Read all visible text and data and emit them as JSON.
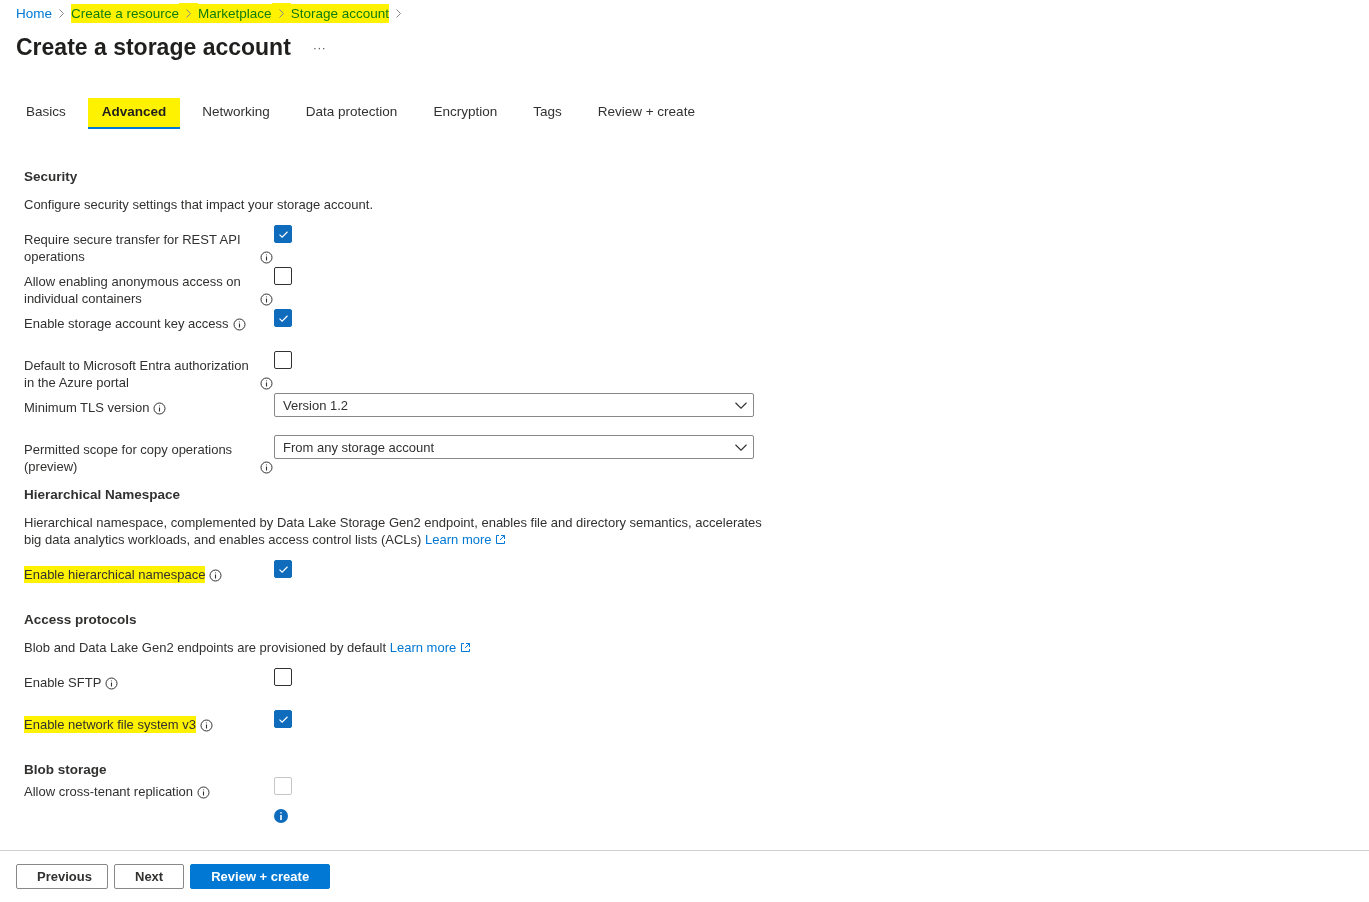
{
  "breadcrumb": [
    {
      "label": "Home",
      "highlighted": false
    },
    {
      "label": "Create a resource",
      "highlighted": true
    },
    {
      "label": "Marketplace",
      "highlighted": true
    },
    {
      "label": "Storage account",
      "highlighted": true
    }
  ],
  "title": "Create a storage account",
  "more_button": "···",
  "tabs": [
    {
      "label": "Basics",
      "selected": false,
      "highlighted": false
    },
    {
      "label": "Advanced",
      "selected": true,
      "highlighted": true
    },
    {
      "label": "Networking",
      "selected": false,
      "highlighted": false
    },
    {
      "label": "Data protection",
      "selected": false,
      "highlighted": false
    },
    {
      "label": "Encryption",
      "selected": false,
      "highlighted": false
    },
    {
      "label": "Tags",
      "selected": false,
      "highlighted": false
    },
    {
      "label": "Review + create",
      "selected": false,
      "highlighted": false
    }
  ],
  "sections": [
    {
      "title": "Security",
      "description": "Configure security settings that impact your storage account.",
      "rows": [
        {
          "kind": "checkbox",
          "label": "Require secure transfer for REST API operations",
          "checked": true,
          "disabled": false,
          "highlighted": false
        },
        {
          "kind": "checkbox",
          "label": "Allow enabling anonymous access on individual containers",
          "checked": false,
          "disabled": false,
          "highlighted": false
        },
        {
          "kind": "checkbox",
          "label": "Enable storage account key access",
          "checked": true,
          "disabled": false,
          "highlighted": false
        },
        {
          "kind": "checkbox",
          "label": "Default to Microsoft Entra authorization in the Azure portal",
          "checked": false,
          "disabled": false,
          "highlighted": false
        },
        {
          "kind": "select",
          "label": "Minimum TLS version",
          "value": "Version 1.2",
          "highlighted": false
        },
        {
          "kind": "select",
          "label": "Permitted scope for copy operations (preview)",
          "value": "From any storage account",
          "highlighted": false
        }
      ]
    },
    {
      "title": "Hierarchical Namespace",
      "description": "Hierarchical namespace, complemented by Data Lake Storage Gen2 endpoint, enables file and directory semantics, accelerates big data analytics workloads, and enables access control lists (ACLs)",
      "learn_more": "Learn more",
      "rows": [
        {
          "kind": "checkbox",
          "label": "Enable hierarchical namespace",
          "checked": true,
          "disabled": false,
          "highlighted": true
        }
      ]
    },
    {
      "title": "Access protocols",
      "description": "Blob and Data Lake Gen2 endpoints are provisioned by default",
      "learn_more": "Learn more",
      "rows": [
        {
          "kind": "checkbox",
          "label": "Enable SFTP",
          "checked": false,
          "disabled": false,
          "highlighted": false
        },
        {
          "kind": "checkbox",
          "label": "Enable network file system v3",
          "checked": true,
          "disabled": false,
          "highlighted": true
        }
      ]
    },
    {
      "title": "Blob storage",
      "rows": [
        {
          "kind": "checkbox",
          "label": "Allow cross-tenant replication",
          "checked": false,
          "disabled": true,
          "highlighted": false,
          "note": true
        }
      ]
    }
  ],
  "footer_buttons": [
    {
      "label": "Previous",
      "kind": "secondary"
    },
    {
      "label": "Next",
      "kind": "secondary"
    },
    {
      "label": "Review + create",
      "kind": "primary"
    }
  ]
}
